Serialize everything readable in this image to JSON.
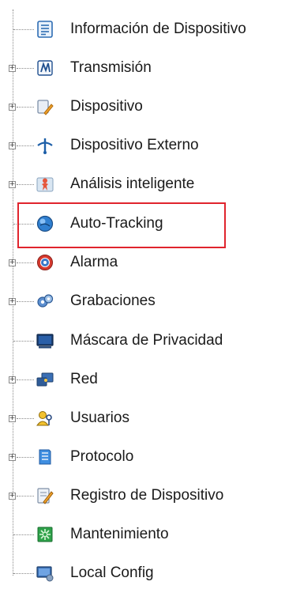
{
  "tree": {
    "items": [
      {
        "label": "Información de Dispositivo",
        "icon": "document-list-icon",
        "expandable": false
      },
      {
        "label": "Transmisión",
        "icon": "video-stream-icon",
        "expandable": true
      },
      {
        "label": "Dispositivo",
        "icon": "device-settings-icon",
        "expandable": true
      },
      {
        "label": "Dispositivo Externo",
        "icon": "external-device-icon",
        "expandable": true
      },
      {
        "label": "Análisis inteligente",
        "icon": "person-analytics-icon",
        "expandable": true
      },
      {
        "label": "Auto-Tracking",
        "icon": "globe-icon",
        "expandable": false,
        "highlighted": true
      },
      {
        "label": "Alarma",
        "icon": "alarm-icon",
        "expandable": true
      },
      {
        "label": "Grabaciones",
        "icon": "recordings-gear-icon",
        "expandable": true
      },
      {
        "label": "Máscara de Privacidad",
        "icon": "monitor-mask-icon",
        "expandable": false
      },
      {
        "label": "Red",
        "icon": "network-icon",
        "expandable": true
      },
      {
        "label": "Usuarios",
        "icon": "users-key-icon",
        "expandable": true
      },
      {
        "label": "Protocolo",
        "icon": "protocol-book-icon",
        "expandable": true
      },
      {
        "label": "Registro de Dispositivo",
        "icon": "log-pencil-icon",
        "expandable": true
      },
      {
        "label": "Mantenimiento",
        "icon": "maintenance-icon",
        "expandable": false
      },
      {
        "label": "Local Config",
        "icon": "local-config-icon",
        "expandable": false
      }
    ]
  },
  "colors": {
    "highlight_border": "#e0242d",
    "tree_line": "#8a8a8a"
  }
}
